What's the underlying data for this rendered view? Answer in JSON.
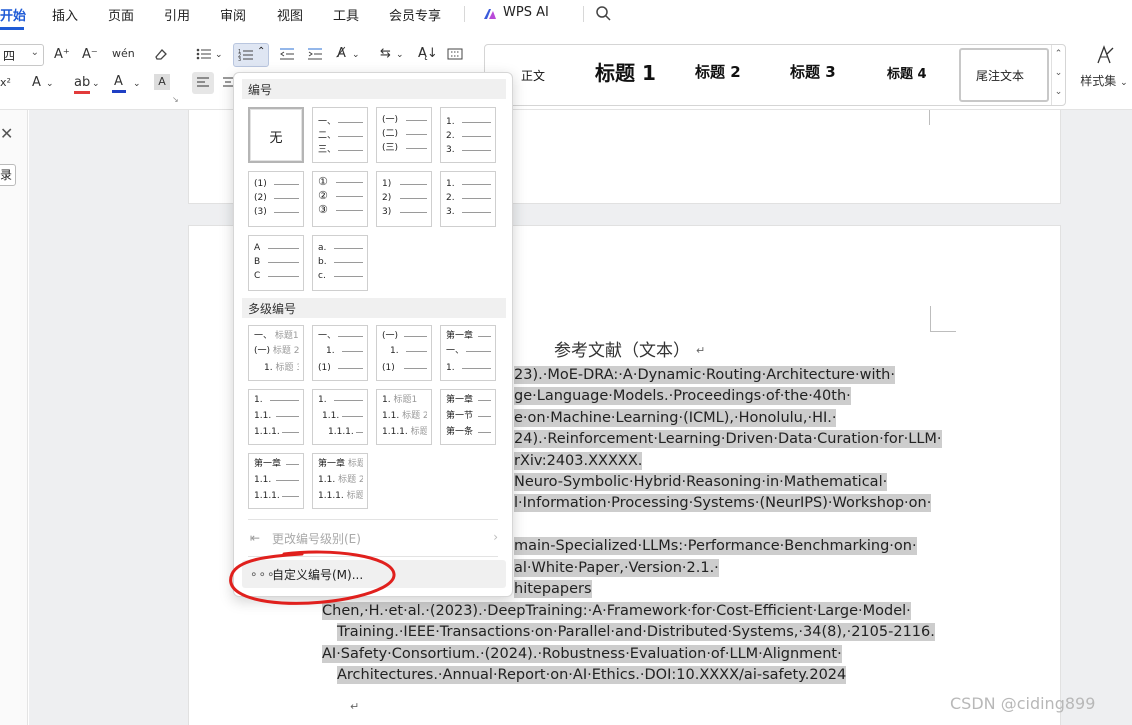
{
  "menubar": {
    "tabs": [
      "开始",
      "插入",
      "页面",
      "引用",
      "审阅",
      "视图",
      "工具",
      "会员专享"
    ],
    "ai_label": "WPS AI",
    "search_icon": "search-icon"
  },
  "ribbon": {
    "font_size": "四",
    "font_grow": "A⁺",
    "font_shrink": "A⁻",
    "phonetic": "wén",
    "clear_format": "eraser-icon",
    "font_color_accent": "#1f3fc4",
    "highlight_accent": "#e23b3b",
    "char_shading": "A",
    "styles": {
      "normal": "正文",
      "heading1": "标题 1",
      "heading2": "标题 2",
      "heading3": "标题 3",
      "heading4": "标题 4",
      "selected": "尾注文本"
    },
    "style_set": "样式集"
  },
  "left_panel": {
    "close": "✕",
    "tab": "录"
  },
  "popup": {
    "numbering_header": "编号",
    "none_label": "无",
    "multilevel_header": "多级编号",
    "change_level": "更改编号级别(E)",
    "custom_numbering": "自定义编号(M)...",
    "tiles": {
      "cn_dun": [
        "一、",
        "二、",
        "三、"
      ],
      "cn_paren": [
        "(一)",
        "(二)",
        "(三)"
      ],
      "num_dot": [
        "1.",
        "2.",
        "3."
      ],
      "paren_num": [
        "(1)",
        "(2)",
        "(3)"
      ],
      "circled": [
        "①",
        "②",
        "③"
      ],
      "num_rparen": [
        "1)",
        "2)",
        "3)"
      ],
      "num_dot_b": [
        "1.",
        "2.",
        "3."
      ],
      "upper": [
        "A",
        "B",
        "C"
      ],
      "lower_dot": [
        "a.",
        "b.",
        "c."
      ]
    },
    "multilevel": {
      "m1": [
        "一、",
        "标题1",
        "(一)",
        "标题 2",
        "1.",
        "标题 3"
      ],
      "m2": [
        "一、",
        "1.",
        "(1)"
      ],
      "m3": [
        "(一)",
        "1.",
        "(1)"
      ],
      "m4": [
        "第一章",
        "一、",
        "1."
      ],
      "m5": [
        "1.",
        "1.1.",
        "1.1.1."
      ],
      "m6": [
        "1.",
        "1.1.",
        "1.1.1."
      ],
      "m7": [
        "1.",
        "标题1",
        "1.1.",
        "标题 2",
        "1.1.1.",
        "标题 3"
      ],
      "m8": [
        "第一章",
        "第一节",
        "第一条"
      ],
      "m9": [
        "第一章",
        "1.1.",
        "1.1.1."
      ],
      "m10": [
        "第一章",
        "标题1",
        "1.1.",
        "标题 2",
        "1.1.1.",
        "标题 3"
      ]
    }
  },
  "document": {
    "ref_title": "参考文献（文本）",
    "lines": [
      "23).·MoE-DRA:·A·Dynamic·Routing·Architecture·with·",
      "ge·Language·Models.·Proceedings·of·the·40th·",
      "e·on·Machine·Learning·(ICML),·Honolulu,·HI.·",
      "24).·Reinforcement·Learning·Driven·Data·Curation·for·LLM·",
      "rXiv:2403.XXXXX.",
      "Neuro-Symbolic·Hybrid·Reasoning·in·Mathematical·",
      "l·Information·Processing·Systems·(NeurIPS)·Workshop·on·",
      "main-Specialized·LLMs:·Performance·Benchmarking·on·",
      "al·White·Paper,·Version·2.1.·",
      "hitepapers",
      "Chen,·H.·et·al.·(2023).·DeepTraining:·A·Framework·for·Cost-Efficient·Large·Model·",
      "Training.·IEEE·Transactions·on·Parallel·and·Distributed·Systems,·34(8),·2105-2116.",
      "AI·Safety·Consortium.·(2024).·Robustness·Evaluation·of·LLM·Alignment·",
      "Architectures.·Annual·Report·on·AI·Ethics.·DOI:10.XXXX/ai-safety.2024"
    ]
  },
  "watermark": "CSDN @ciding899"
}
